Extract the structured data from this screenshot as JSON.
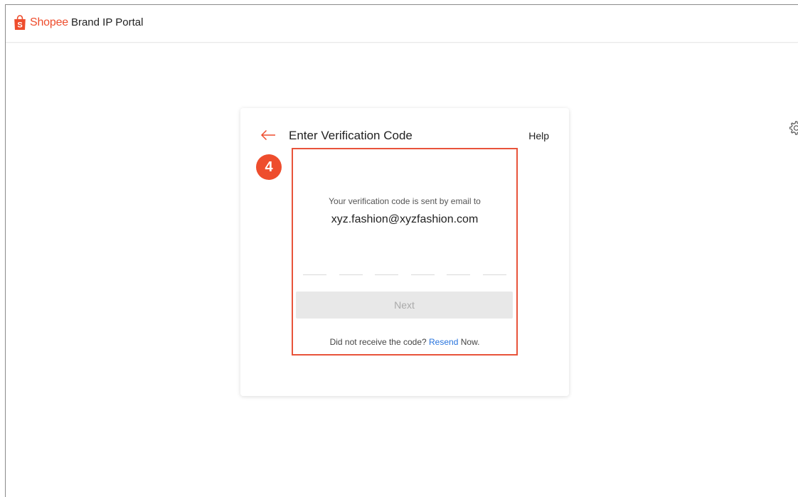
{
  "header": {
    "brand_name": "Shopee",
    "portal_name": "Brand IP Portal"
  },
  "icons": {
    "logo": "shopee-bag-icon",
    "back": "arrow-left-icon",
    "settings": "gear-icon"
  },
  "card": {
    "title": "Enter Verification Code",
    "help_label": "Help",
    "step_number": "4",
    "sent_text": "Your verification code is sent by email to",
    "email": "xyz.fashion@xyzfashion.com",
    "code_slots": [
      "",
      "",
      "",
      "",
      "",
      ""
    ],
    "next_label": "Next",
    "resend_prefix": "Did not receive the code? ",
    "resend_link": "Resend",
    "resend_suffix": " Now."
  },
  "colors": {
    "brand": "#ee4d2d",
    "highlight": "#e8533a",
    "link": "#2673dd",
    "button_disabled_bg": "#e8e8e8",
    "button_disabled_text": "#aaaaaa"
  }
}
